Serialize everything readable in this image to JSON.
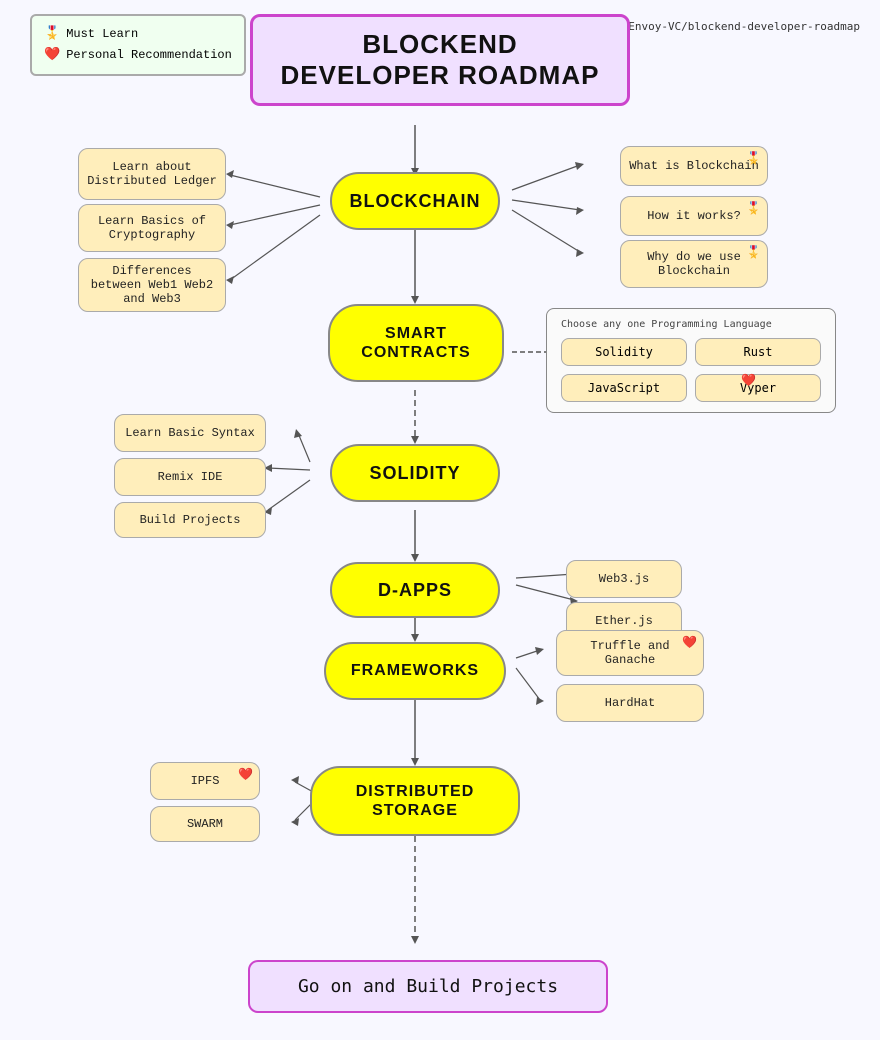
{
  "github": "Envoy-VC/blockend-developer-roadmap",
  "title": {
    "line1": "BLOCKEND",
    "line2": "DEVELOPER ROADMAP"
  },
  "legend": {
    "must_learn": "Must Learn",
    "personal": "Personal Recommendation"
  },
  "nodes": {
    "blockchain": "BLOCKCHAIN",
    "smart_contracts": "SMART CONTRACTS",
    "solidity": "SOLIDITY",
    "dapps": "D-APPS",
    "frameworks": "FRAMEWORKS",
    "distributed_storage": "DISTRIBUTED STORAGE"
  },
  "blockchain_left": [
    "Learn about Distributed Ledger",
    "Learn Basics of Cryptography",
    "Differences between Web1 Web2 and Web3"
  ],
  "blockchain_right": [
    "What is Blockchain",
    "How it works?",
    "Why do we use Blockchain"
  ],
  "smart_contracts_choice": {
    "label": "Choose any one Programming Language",
    "options": [
      "Solidity",
      "Rust",
      "JavaScript",
      "Vyper"
    ]
  },
  "solidity_left": [
    "Learn Basic Syntax",
    "Remix IDE",
    "Build Projects"
  ],
  "dapps_right": [
    "Web3.js",
    "Ether.js"
  ],
  "frameworks_right": [
    "Truffle and Ganache",
    "HardHat"
  ],
  "distributed_left": [
    "IPFS",
    "SWARM"
  ],
  "final": "Go on and Build Projects"
}
